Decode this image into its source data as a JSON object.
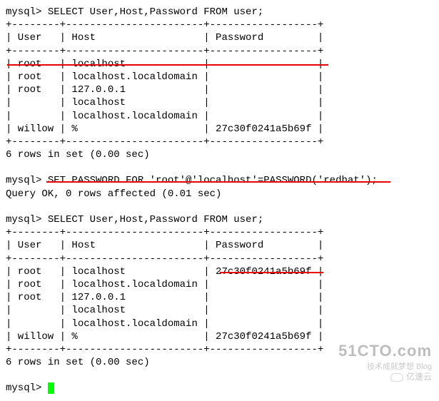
{
  "prompts": {
    "p1": "mysql> ",
    "p2": "mysql> ",
    "p3": "mysql> ",
    "p4": "mysql> "
  },
  "queries": {
    "q1": "SELECT User,Host,Password FROM user;",
    "q2": "SET PASSWORD FOR 'root'@'localhost'=PASSWORD('redhat');",
    "q3": "SELECT User,Host,Password FROM user;"
  },
  "sep": {
    "border": "+--------+-----------------------+------------------+",
    "header": "| User   | Host                  | Password         |"
  },
  "table1": {
    "rows": [
      "| root   | localhost             |                  |",
      "| root   | localhost.localdomain |                  |",
      "| root   | 127.0.0.1             |                  |",
      "|        | localhost             |                  |",
      "|        | localhost.localdomain |                  |",
      "| willow | %                     | 27c30f0241a5b69f |"
    ],
    "footer": "6 rows in set (0.00 sec)"
  },
  "result2": "Query OK, 0 rows affected (0.01 sec)",
  "table2": {
    "rows": [
      "| root   | localhost             | 27c30f0241a5b69f |",
      "| root   | localhost.localdomain |                  |",
      "| root   | 127.0.0.1             |                  |",
      "|        | localhost             |                  |",
      "|        | localhost.localdomain |                  |",
      "| willow | %                     | 27c30f0241a5b69f |"
    ],
    "footer": "6 rows in set (0.00 sec)"
  },
  "watermark": {
    "top": "51CTO.com",
    "mid": "技术成就梦想 Blog",
    "bot": "亿速云"
  }
}
